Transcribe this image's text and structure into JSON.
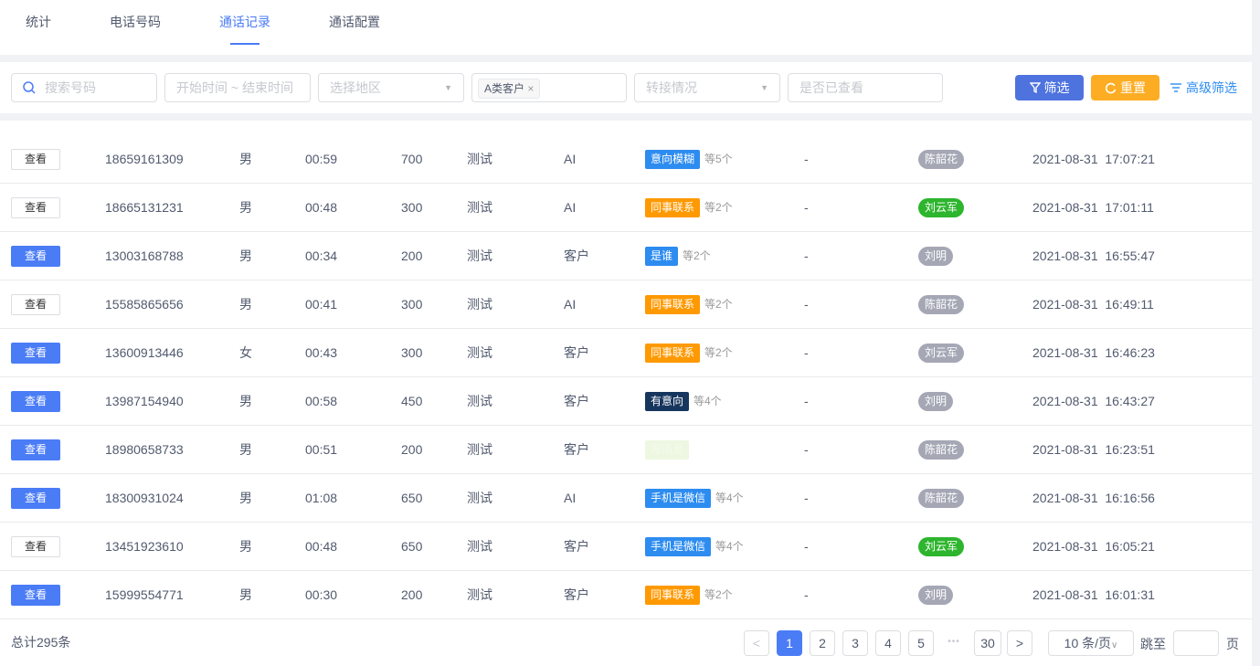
{
  "tabs": [
    {
      "label": "统计"
    },
    {
      "label": "电话号码"
    },
    {
      "label": "通话记录",
      "active": true
    },
    {
      "label": "通话配置"
    }
  ],
  "filters": {
    "search_placeholder": "搜索号码",
    "date_placeholder": "开始时间 ~ 结束时间",
    "region_placeholder": "选择地区",
    "customer_chip": "A类客户",
    "transfer_placeholder": "转接情况",
    "viewed_placeholder": "是否已查看",
    "filter_label": "筛选",
    "reset_label": "重置",
    "advanced_label": "高级筛选"
  },
  "colors": {
    "accent": "#4a7cf6",
    "filter_btn": "#4e73df",
    "reset_btn": "#fcad23",
    "tag_blue": "#2d8cf0",
    "tag_orange": "#ff9900",
    "tag_navy": "#17365d",
    "tag_pale": "#edf7e1",
    "person_gray": "#a5a7b5",
    "person_green": "#2db52d"
  },
  "view_label": "查看",
  "rows": [
    {
      "viewed": true,
      "phone": "18659161309",
      "gender": "男",
      "duration": "00:59",
      "score": "700",
      "task": "测试",
      "source": "AI",
      "tag": "意向模糊",
      "tag_color": "blue",
      "more": "等5个",
      "transfer": "-",
      "person": "陈韶花",
      "person_color": "gray",
      "time": "2021-08-31  17:07:21"
    },
    {
      "viewed": true,
      "phone": "18665131231",
      "gender": "男",
      "duration": "00:48",
      "score": "300",
      "task": "测试",
      "source": "AI",
      "tag": "同事联系",
      "tag_color": "orange",
      "more": "等2个",
      "transfer": "-",
      "person": "刘云军",
      "person_color": "green",
      "time": "2021-08-31  17:01:11"
    },
    {
      "viewed": false,
      "phone": "13003168788",
      "gender": "男",
      "duration": "00:34",
      "score": "200",
      "task": "测试",
      "source": "客户",
      "tag": "是谁",
      "tag_color": "blue",
      "more": "等2个",
      "transfer": "-",
      "person": "刘明",
      "person_color": "gray",
      "time": "2021-08-31  16:55:47"
    },
    {
      "viewed": true,
      "phone": "15585865656",
      "gender": "男",
      "duration": "00:41",
      "score": "300",
      "task": "测试",
      "source": "AI",
      "tag": "同事联系",
      "tag_color": "orange",
      "more": "等2个",
      "transfer": "-",
      "person": "陈韶花",
      "person_color": "gray",
      "time": "2021-08-31  16:49:11"
    },
    {
      "viewed": false,
      "phone": "13600913446",
      "gender": "女",
      "duration": "00:43",
      "score": "300",
      "task": "测试",
      "source": "客户",
      "tag": "同事联系",
      "tag_color": "orange",
      "more": "等2个",
      "transfer": "-",
      "person": "刘云军",
      "person_color": "gray",
      "time": "2021-08-31  16:46:23"
    },
    {
      "viewed": false,
      "phone": "13987154940",
      "gender": "男",
      "duration": "00:58",
      "score": "450",
      "task": "测试",
      "source": "客户",
      "tag": "有意向",
      "tag_color": "navy",
      "more": "等4个",
      "transfer": "-",
      "person": "刘明",
      "person_color": "gray",
      "time": "2021-08-31  16:43:27"
    },
    {
      "viewed": false,
      "phone": "18980658733",
      "gender": "男",
      "duration": "00:51",
      "score": "200",
      "task": "测试",
      "source": "客户",
      "tag": "发消息",
      "tag_color": "pale",
      "more": "",
      "transfer": "-",
      "person": "陈韶花",
      "person_color": "gray",
      "time": "2021-08-31  16:23:51"
    },
    {
      "viewed": false,
      "phone": "18300931024",
      "gender": "男",
      "duration": "01:08",
      "score": "650",
      "task": "测试",
      "source": "AI",
      "tag": "手机是微信",
      "tag_color": "blue",
      "more": "等4个",
      "transfer": "-",
      "person": "陈韶花",
      "person_color": "gray",
      "time": "2021-08-31  16:16:56"
    },
    {
      "viewed": true,
      "phone": "13451923610",
      "gender": "男",
      "duration": "00:48",
      "score": "650",
      "task": "测试",
      "source": "客户",
      "tag": "手机是微信",
      "tag_color": "blue",
      "more": "等4个",
      "transfer": "-",
      "person": "刘云军",
      "person_color": "green",
      "time": "2021-08-31  16:05:21"
    },
    {
      "viewed": false,
      "phone": "15999554771",
      "gender": "男",
      "duration": "00:30",
      "score": "200",
      "task": "测试",
      "source": "客户",
      "tag": "同事联系",
      "tag_color": "orange",
      "more": "等2个",
      "transfer": "-",
      "person": "刘明",
      "person_color": "gray",
      "time": "2021-08-31  16:01:31"
    }
  ],
  "pagination": {
    "total": "总计295条",
    "pages": [
      "1",
      "2",
      "3",
      "4",
      "5"
    ],
    "last": "30",
    "current": "1",
    "ellipsis": "•••",
    "prev": "<",
    "next": ">",
    "page_size": "10 条/页",
    "jump_label": "跳至",
    "page_suffix": "页"
  }
}
